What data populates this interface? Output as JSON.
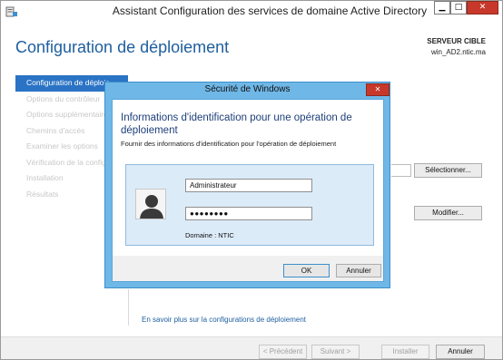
{
  "window": {
    "title": "Assistant Configuration des services de domaine Active Directory",
    "minimize_glyph": "▁",
    "maximize_glyph": "□",
    "close_glyph": "✕"
  },
  "header": {
    "page_title": "Configuration de déploiement",
    "server_label": "SERVEUR CIBLE",
    "server_name": "win_AD2.ntic.ma"
  },
  "sidebar": {
    "items": [
      {
        "label": "Configuration de déploie",
        "active": true
      },
      {
        "label": "Options du contrôleur",
        "active": false
      },
      {
        "label": "Options supplémentaires",
        "active": false
      },
      {
        "label": "Chemins d'accès",
        "active": false
      },
      {
        "label": "Examiner les options",
        "active": false
      },
      {
        "label": "Vérification de la configuration",
        "active": false
      },
      {
        "label": "Installation",
        "active": false
      },
      {
        "label": "Résultats",
        "active": false
      }
    ]
  },
  "main": {
    "select_button": "Sélectionner...",
    "modify_button": "Modifier...",
    "learn_more_link": "En savoir plus sur la configurations de déploiement"
  },
  "footer": {
    "previous": "< Précédent",
    "next": "Suivant >",
    "install": "Installer",
    "cancel": "Annuler"
  },
  "dialog": {
    "title": "Sécurité de Windows",
    "close_glyph": "✕",
    "heading": "Informations d'identification pour une opération de déploiement",
    "subtitle": "Fournir des informations d'identification pour l'opération de déploiement",
    "username_value": "Administrateur",
    "password_value": "●●●●●●●●",
    "domain_label": "Domaine : NTIC",
    "ok_button": "OK",
    "cancel_button": "Annuler"
  },
  "icons": {
    "app": "server-roles-icon",
    "user": "user-avatar-icon"
  },
  "colors": {
    "accent": "#2a73c5",
    "title_blue": "#1e5e9e",
    "dialog_frame": "#6fb7e6",
    "close_red": "#c7382a"
  }
}
